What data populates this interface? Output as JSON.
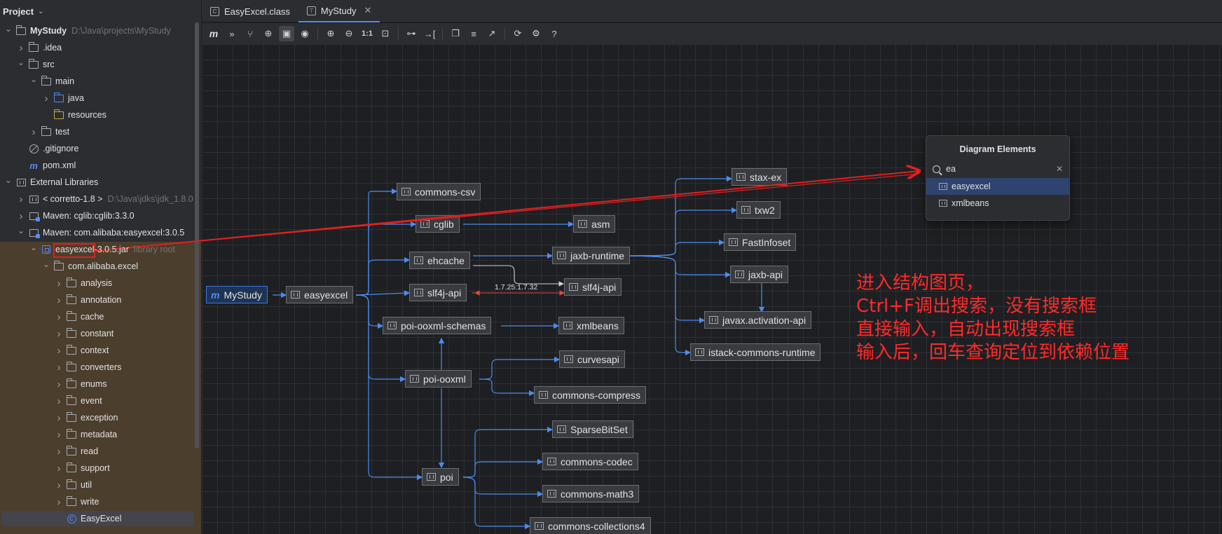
{
  "sidebar": {
    "title": "Project",
    "tree": [
      {
        "label": "MyStudy",
        "hint": "D:\\Java\\projects\\MyStudy",
        "icon": "folder",
        "depth": 0,
        "arrow": "down",
        "bold": true
      },
      {
        "label": ".idea",
        "icon": "folder",
        "depth": 1,
        "arrow": "right"
      },
      {
        "label": "src",
        "icon": "folder",
        "depth": 1,
        "arrow": "down"
      },
      {
        "label": "main",
        "icon": "folder",
        "depth": 2,
        "arrow": "down"
      },
      {
        "label": "java",
        "icon": "folder-blue",
        "depth": 3,
        "arrow": "right"
      },
      {
        "label": "resources",
        "icon": "folder-resources",
        "depth": 3,
        "arrow": "none"
      },
      {
        "label": "test",
        "icon": "folder",
        "depth": 2,
        "arrow": "right"
      },
      {
        "label": ".gitignore",
        "icon": "ignore",
        "depth": 1,
        "arrow": "none"
      },
      {
        "label": "pom.xml",
        "icon": "maven-m",
        "depth": 1,
        "arrow": "none"
      },
      {
        "label": "External Libraries",
        "icon": "library",
        "depth": 0,
        "arrow": "down"
      },
      {
        "label": "< corretto-1.8 >",
        "hint": "D:\\Java\\jdks\\jdk_1.8.0",
        "icon": "library",
        "depth": 1,
        "arrow": "right"
      },
      {
        "label": "Maven: cglib:cglib:3.3.0",
        "icon": "maven-lib",
        "depth": 1,
        "arrow": "right"
      },
      {
        "label": "Maven: com.alibaba:easyexcel:3.0.5",
        "icon": "maven-lib",
        "depth": 1,
        "arrow": "down"
      },
      {
        "label": "easyexcel-3.0.5.jar",
        "hint": "library root",
        "icon": "jar",
        "depth": 2,
        "arrow": "down"
      },
      {
        "label": "com.alibaba.excel",
        "icon": "folder",
        "depth": 3,
        "arrow": "down"
      },
      {
        "label": "analysis",
        "icon": "folder",
        "depth": 4,
        "arrow": "right"
      },
      {
        "label": "annotation",
        "icon": "folder",
        "depth": 4,
        "arrow": "right"
      },
      {
        "label": "cache",
        "icon": "folder",
        "depth": 4,
        "arrow": "right"
      },
      {
        "label": "constant",
        "icon": "folder",
        "depth": 4,
        "arrow": "right"
      },
      {
        "label": "context",
        "icon": "folder",
        "depth": 4,
        "arrow": "right"
      },
      {
        "label": "converters",
        "icon": "folder",
        "depth": 4,
        "arrow": "right"
      },
      {
        "label": "enums",
        "icon": "folder",
        "depth": 4,
        "arrow": "right"
      },
      {
        "label": "event",
        "icon": "folder",
        "depth": 4,
        "arrow": "right"
      },
      {
        "label": "exception",
        "icon": "folder",
        "depth": 4,
        "arrow": "right"
      },
      {
        "label": "metadata",
        "icon": "folder",
        "depth": 4,
        "arrow": "right"
      },
      {
        "label": "read",
        "icon": "folder",
        "depth": 4,
        "arrow": "right"
      },
      {
        "label": "support",
        "icon": "folder",
        "depth": 4,
        "arrow": "right"
      },
      {
        "label": "util",
        "icon": "folder",
        "depth": 4,
        "arrow": "right"
      },
      {
        "label": "write",
        "icon": "folder",
        "depth": 4,
        "arrow": "right"
      },
      {
        "label": "EasyExcel",
        "icon": "class",
        "depth": 4,
        "arrow": "none",
        "selected": true
      }
    ]
  },
  "tabs": [
    {
      "label": "EasyExcel.class",
      "icon": "class-icon",
      "active": false
    },
    {
      "label": "MyStudy",
      "icon": "diagram-icon",
      "active": true
    }
  ],
  "toolbar": {
    "zoom_actual_label": "1:1",
    "buttons": [
      "maven-m-icon",
      "expand-icon",
      "hierarchy-icon",
      "find-icon",
      "select-icon",
      "eye-icon",
      "zoom-in-icon",
      "zoom-out-icon",
      "actual-size-icon",
      "fit-icon",
      "layout-icon",
      "apply-layout-icon",
      "copy-icon",
      "export-icon",
      "share-icon",
      "refresh-icon",
      "settings-icon",
      "help-icon"
    ]
  },
  "diagram": {
    "nodes": {
      "mystudy": "MyStudy",
      "easyexcel": "easyexcel",
      "commons_csv": "commons-csv",
      "cglib": "cglib",
      "asm": "asm",
      "ehcache": "ehcache",
      "jaxb_runtime": "jaxb-runtime",
      "slf4j_api_a": "slf4j-api",
      "slf4j_api_b": "slf4j-api",
      "poi_ooxml_schemas": "poi-ooxml-schemas",
      "xmlbeans": "xmlbeans",
      "poi_ooxml": "poi-ooxml",
      "curvesapi": "curvesapi",
      "commons_compress": "commons-compress",
      "sparsebitset": "SparseBitSet",
      "commons_codec": "commons-codec",
      "commons_math3": "commons-math3",
      "commons_collections4": "commons-collections4",
      "poi": "poi",
      "stax_ex": "stax-ex",
      "txw2": "txw2",
      "fastinfoset": "FastInfoset",
      "jaxb_api": "jaxb-api",
      "javax_activation_api": "javax.activation-api",
      "istack_commons_runtime": "istack-commons-runtime"
    },
    "conflict_label": "1.7.25:1.7.32"
  },
  "popup": {
    "title": "Diagram Elements",
    "query": "ea",
    "results": [
      {
        "label": "easyexcel",
        "selected": true
      },
      {
        "label": "xmlbeans",
        "selected": false
      }
    ]
  },
  "annotation": {
    "lines": [
      "进入结构图页，",
      "Ctrl+F调出搜索，没有搜索框",
      "直接输入，自动出现搜索框",
      "输入后，回车查询定位到依赖位置"
    ],
    "color": "#ff2a2a"
  },
  "colors": {
    "accent": "#548af7",
    "edge": "#4a8df0",
    "conflict": "#e04848",
    "libroot_bg": "#4c3e2c"
  }
}
